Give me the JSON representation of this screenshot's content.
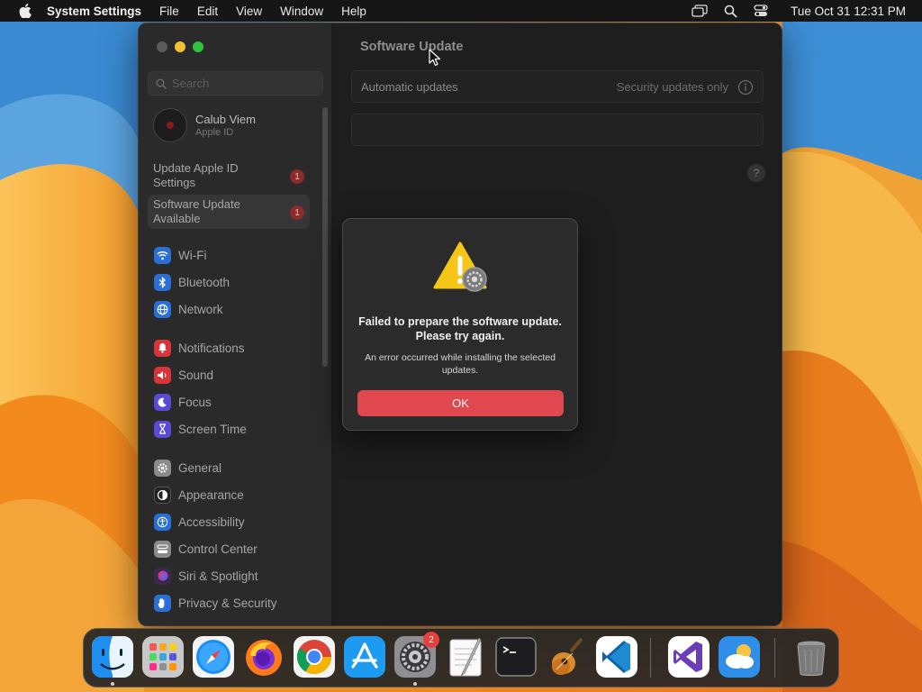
{
  "menubar": {
    "app_name": "System Settings",
    "menus": [
      "File",
      "Edit",
      "View",
      "Window",
      "Help"
    ],
    "clock": "Tue Oct 31  12:31 PM"
  },
  "sidebar": {
    "search_placeholder": "Search",
    "profile": {
      "name": "Calub Viem",
      "subtitle": "Apple ID"
    },
    "notices": [
      {
        "label": "Update Apple ID Settings",
        "badge": "1"
      },
      {
        "label": "Software Update Available",
        "badge": "1"
      }
    ],
    "items": [
      {
        "label": "Wi-Fi",
        "icon": "wifi-icon",
        "color": "#2a6fd6"
      },
      {
        "label": "Bluetooth",
        "icon": "bluetooth-icon",
        "color": "#2a6fd6"
      },
      {
        "label": "Network",
        "icon": "globe-icon",
        "color": "#2a6fd6"
      },
      {
        "label": "Notifications",
        "icon": "bell-icon",
        "color": "#d8353a"
      },
      {
        "label": "Sound",
        "icon": "speaker-icon",
        "color": "#d8353a"
      },
      {
        "label": "Focus",
        "icon": "moon-icon",
        "color": "#5b4ad6"
      },
      {
        "label": "Screen Time",
        "icon": "hourglass-icon",
        "color": "#5b4ad6"
      },
      {
        "label": "General",
        "icon": "gear-icon",
        "color": "#8a8a8a"
      },
      {
        "label": "Appearance",
        "icon": "appearance-icon",
        "color": "#222222"
      },
      {
        "label": "Accessibility",
        "icon": "accessibility-icon",
        "color": "#2a6fd6"
      },
      {
        "label": "Control Center",
        "icon": "control-center-icon",
        "color": "#8a8a8a"
      },
      {
        "label": "Siri & Spotlight",
        "icon": "siri-icon",
        "color": "#b03ad0"
      },
      {
        "label": "Privacy & Security",
        "icon": "hand-icon",
        "color": "#2a6fd6"
      }
    ]
  },
  "content": {
    "title": "Software Update",
    "automatic_updates_label": "Automatic updates",
    "automatic_updates_value": "Security updates only",
    "help": "?"
  },
  "dialog": {
    "title": "Failed to prepare the software update. Please try again.",
    "message": "An error occurred while installing the selected updates.",
    "ok_label": "OK"
  },
  "dock": {
    "apps": [
      "Finder",
      "Launchpad",
      "Safari",
      "Firefox",
      "Google Chrome",
      "App Store",
      "System Settings",
      "TextEdit",
      "Terminal",
      "GarageBand",
      "Visual Studio Code",
      "Visual Studio",
      "Weather",
      "Trash"
    ],
    "system_settings_badge": "2"
  }
}
